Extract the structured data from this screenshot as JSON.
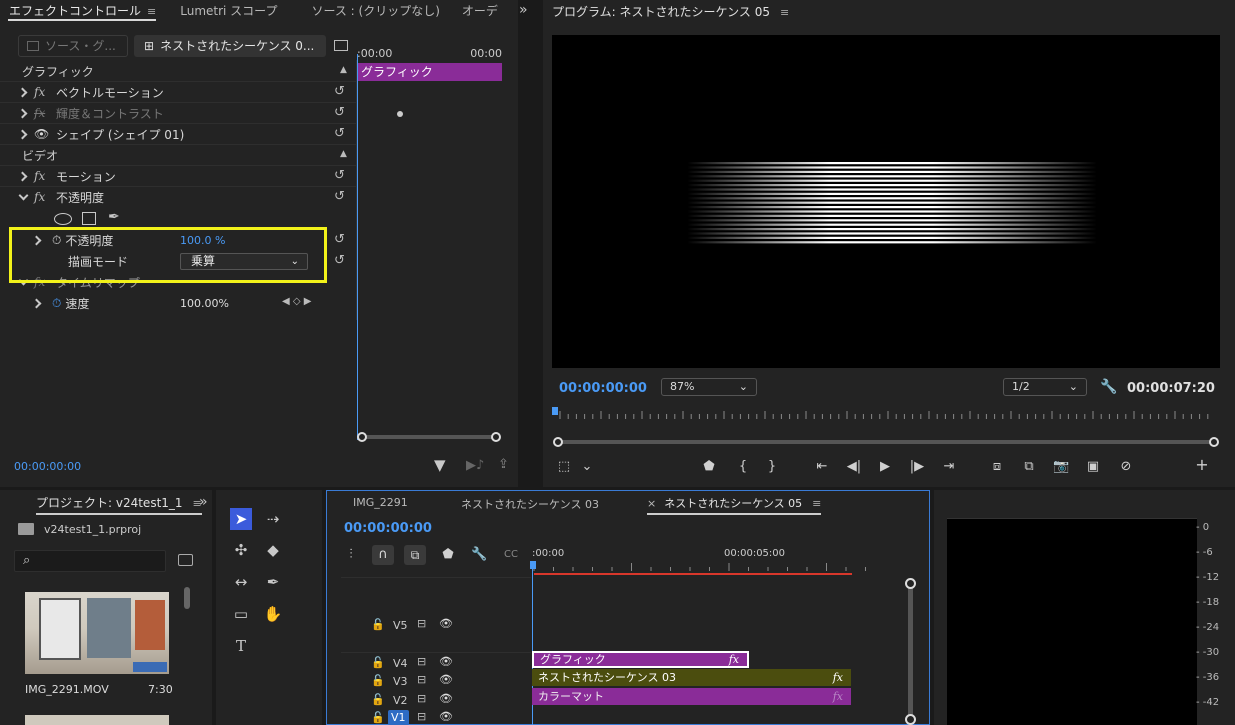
{
  "effect_panel": {
    "tabs": [
      "エフェクトコントロール",
      "Lumetri スコープ",
      "ソース : (クリップなし)",
      "オーデ"
    ],
    "menu_icon": "≡",
    "overflow": "»",
    "source_btn": "ソース・グ...",
    "seq_btn": "ネストされたシーケンス 0...",
    "timecode_start": ":00:00",
    "timecode_end": "00:00",
    "clip_label": "グラフィック",
    "section_graphic": "グラフィック",
    "section_video": "ビデオ",
    "rows": {
      "vector_motion": "ベクトルモーション",
      "brightness": "輝度＆コントラスト",
      "shape": "シェイプ (シェイプ 01)",
      "motion": "モーション",
      "opacity": "不透明度",
      "opacity_param": "不透明度",
      "opacity_value": "100.0 %",
      "blend_mode": "描画モード",
      "blend_value": "乗算",
      "time_remap": "タイムリマップ",
      "speed": "速度",
      "speed_value": "100.00%"
    },
    "current_time": "00:00:00:00"
  },
  "program": {
    "title": "プログラム: ネストされたシーケンス 05",
    "menu_icon": "≡",
    "timecode": "00:00:00:00",
    "zoom": "87%",
    "resolution": "1/2",
    "duration": "00:00:07:20"
  },
  "project": {
    "title": "プロジェクト: v24test1_1",
    "menu_icon": "≡",
    "overflow": "»",
    "file": "v24test1_1.prproj",
    "search_placeholder": "",
    "item_name": "IMG_2291.MOV",
    "item_duration": "7:30"
  },
  "timeline": {
    "tabs": [
      "IMG_2291",
      "ネストされたシーケンス 03",
      "ネストされたシーケンス 05"
    ],
    "close": "×",
    "menu_icon": "≡",
    "timecode": "00:00:00:00",
    "ruler_start": ":00:00",
    "ruler_mid": "00:00:05:00",
    "tracks": [
      "V5",
      "V4",
      "V3",
      "V2",
      "V1"
    ],
    "clips": {
      "v4": "グラフィック",
      "v3": "ネストされたシーケンス 03",
      "v2": "カラーマット"
    },
    "fx": "fx"
  },
  "meter": {
    "labels": [
      "0",
      "-6",
      "-12",
      "-18",
      "-24",
      "-30",
      "-36",
      "-42"
    ]
  },
  "colors": {
    "accent_blue": "#4a9af5",
    "highlight_yellow": "#f2f21a",
    "clip_purple": "#8a2c98",
    "clip_olive": "#4b4d0e"
  }
}
